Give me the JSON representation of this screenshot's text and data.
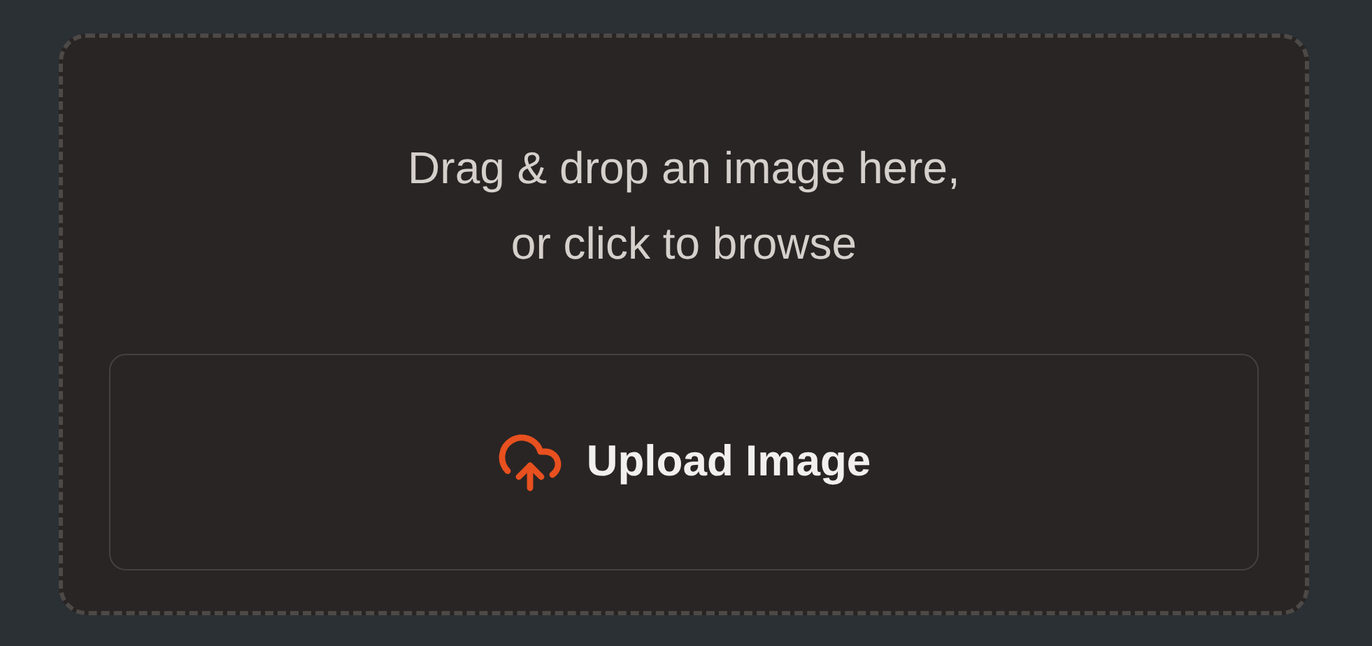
{
  "dropzone": {
    "prompt": "Drag & drop an image here,\nor click to browse",
    "button": {
      "label": "Upload Image"
    }
  }
}
